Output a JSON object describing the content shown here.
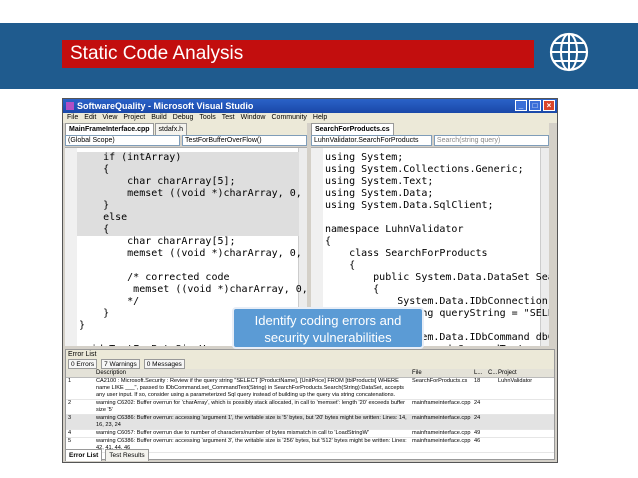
{
  "slide": {
    "title": "Static Code Analysis"
  },
  "vs": {
    "window_title": "SoftwareQuality - Microsoft Visual Studio",
    "menu": [
      "File",
      "Edit",
      "View",
      "Project",
      "Build",
      "Debug",
      "Tools",
      "Test",
      "Window",
      "Community",
      "Help"
    ],
    "left_tabs": [
      "MainFrameInterface.cpp",
      "stdafx.h"
    ],
    "right_tabs": [
      "SearchForProducts.cs"
    ],
    "left_combo_scope": "(Global Scope)",
    "left_combo_func": "TestForBufferOverFlow()",
    "right_combo_class": "LuhnValidator.SearchForProducts",
    "right_combo_member": "Search(string query)",
    "left_code": [
      "    if (intArray)",
      "    {",
      "        char charArray[5];",
      "        memset ((void *)charArray, 0,",
      "    }",
      "    else",
      "    {",
      "        char charArray[5];",
      "        memset ((void *)charArray, 0,",
      "",
      "        /* corrected code",
      "         memset ((void *)charArray, 0,",
      "        */",
      "    }",
      "}",
      "",
      "void TestForByteSizeVersusCharacter",
      "{",
      "    /*"
    ],
    "right_code": [
      "using System;",
      "using System.Collections.Generic;",
      "using System.Text;",
      "using System.Data;",
      "using System.Data.SqlClient;",
      "",
      "namespace LuhnValidator",
      "{",
      "    class SearchForProducts",
      "    {",
      "        public System.Data.DataSet Sea",
      "        {",
      "            System.Data.IDbConnection",
      "            string queryString = \"SELE",
      "",
      "            System.Data.IDbCommand dbC",
      "            dbCommand.CommandText = qu",
      "            dbCommand.Connection = dbC"
    ],
    "error_list": {
      "title": "Error List",
      "errors_btn": "0 Errors",
      "warnings_btn": "7 Warnings",
      "messages_btn": "0 Messages",
      "headers": [
        "Description",
        "File",
        "L...",
        "C...",
        "Project"
      ],
      "rows": [
        {
          "num": "1",
          "desc": "CA2100 : Microsoft.Security : Review if the query string \"SELECT [ProductName], [UnitPrice] FROM [tblProducts] WHERE name LIKE ___\", passed to IDbCommand.set_CommandText(String) in SearchForProducts.Search(String):DataSet, accepts any user input. If so, consider using a parameterized Sql query instead of building up the query via string concatenations.",
          "file": "SearchForProducts.cs",
          "line": "18",
          "col": "",
          "proj": "LuhnValidator"
        },
        {
          "num": "2",
          "desc": "warning C6202: Buffer overrun for 'charArray', which is possibly stack allocated, in call to 'memset': length '20' exceeds buffer size '5'",
          "file": "mainframeinterface.cpp",
          "line": "24",
          "col": "",
          "proj": ""
        },
        {
          "num": "3",
          "desc": "warning C6386: Buffer overrun: accessing 'argument 1', the writable size is '5' bytes, but '20' bytes might be written: Lines: 14, 16, 23, 24",
          "file": "mainframeinterface.cpp",
          "line": "24",
          "col": "",
          "proj": ""
        },
        {
          "num": "4",
          "desc": "warning C6057: Buffer overrun due to number of characters/number of bytes mismatch in call to 'LoadStringW'",
          "file": "mainframeinterface.cpp",
          "line": "49",
          "col": "",
          "proj": ""
        },
        {
          "num": "5",
          "desc": "warning C6386: Buffer overrun: accessing 'argument 3', the writable size is '256' bytes, but '512' bytes might be written: Lines: 42, 41, 44, 46",
          "file": "mainframeinterface.cpp",
          "line": "46",
          "col": "",
          "proj": ""
        }
      ]
    },
    "bottom_tabs": [
      "Error List",
      "Test Results"
    ]
  },
  "callout": {
    "line1": "Identify coding errors and",
    "line2": "security vulnerabilities"
  },
  "colors": {
    "header_blue": "#1f5b8e",
    "title_red": "#c20e0e",
    "callout_blue": "#5b9bd5"
  }
}
